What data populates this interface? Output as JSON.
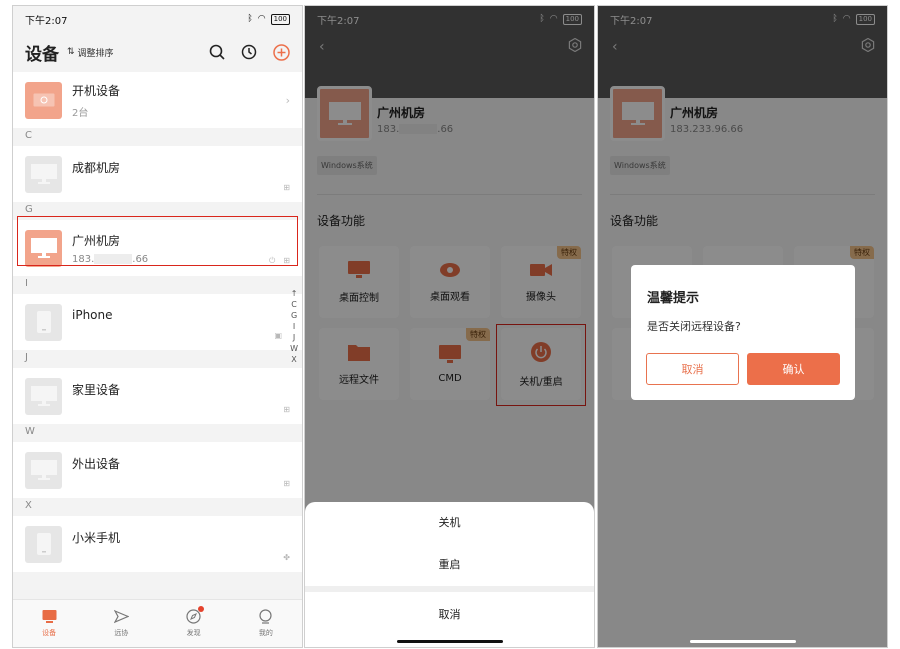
{
  "status": {
    "time": "下午2:07",
    "battery": "100"
  },
  "devices_page": {
    "title": "设备",
    "sort_label": "调整排序",
    "boot_devices": {
      "name": "开机设备",
      "count": "2台"
    },
    "sections": {
      "c": "C",
      "g": "G",
      "i": "I",
      "j": "J",
      "w": "W",
      "x": "X"
    },
    "devices": {
      "chengdu": {
        "name": "成都机房"
      },
      "guangzhou": {
        "name": "广州机房",
        "ip_start": "183.",
        "ip_end": ".66"
      },
      "iphone": {
        "name": "iPhone"
      },
      "home": {
        "name": "家里设备"
      },
      "out": {
        "name": "外出设备"
      },
      "xiaomi": {
        "name": "小米手机"
      }
    },
    "index": [
      "↑",
      "C",
      "G",
      "I",
      "J",
      "W",
      "X"
    ]
  },
  "tabs": [
    {
      "label": "设备"
    },
    {
      "label": "远协"
    },
    {
      "label": "发现"
    },
    {
      "label": "我的"
    }
  ],
  "detail": {
    "name": "广州机房",
    "ip_partial_start": "183.",
    "ip_partial_end": ".66",
    "ip_full": "183.233.96.66",
    "os": "Windows系统",
    "features_title": "设备功能",
    "features": {
      "desktop_control": "桌面控制",
      "desktop_view": "桌面观看",
      "camera": "摄像头",
      "remote_files": "远程文件",
      "cmd": "CMD",
      "power": "关机/重启"
    },
    "badge": "特权"
  },
  "sheet": {
    "shutdown": "关机",
    "restart": "重启",
    "cancel": "取消"
  },
  "dialog": {
    "title": "温馨提示",
    "message": "是否关闭远程设备?",
    "cancel": "取消",
    "confirm": "确认"
  },
  "colors": {
    "accent": "#ec6f4a",
    "highlight": "#d9261c",
    "badge": "#f4c38a"
  }
}
